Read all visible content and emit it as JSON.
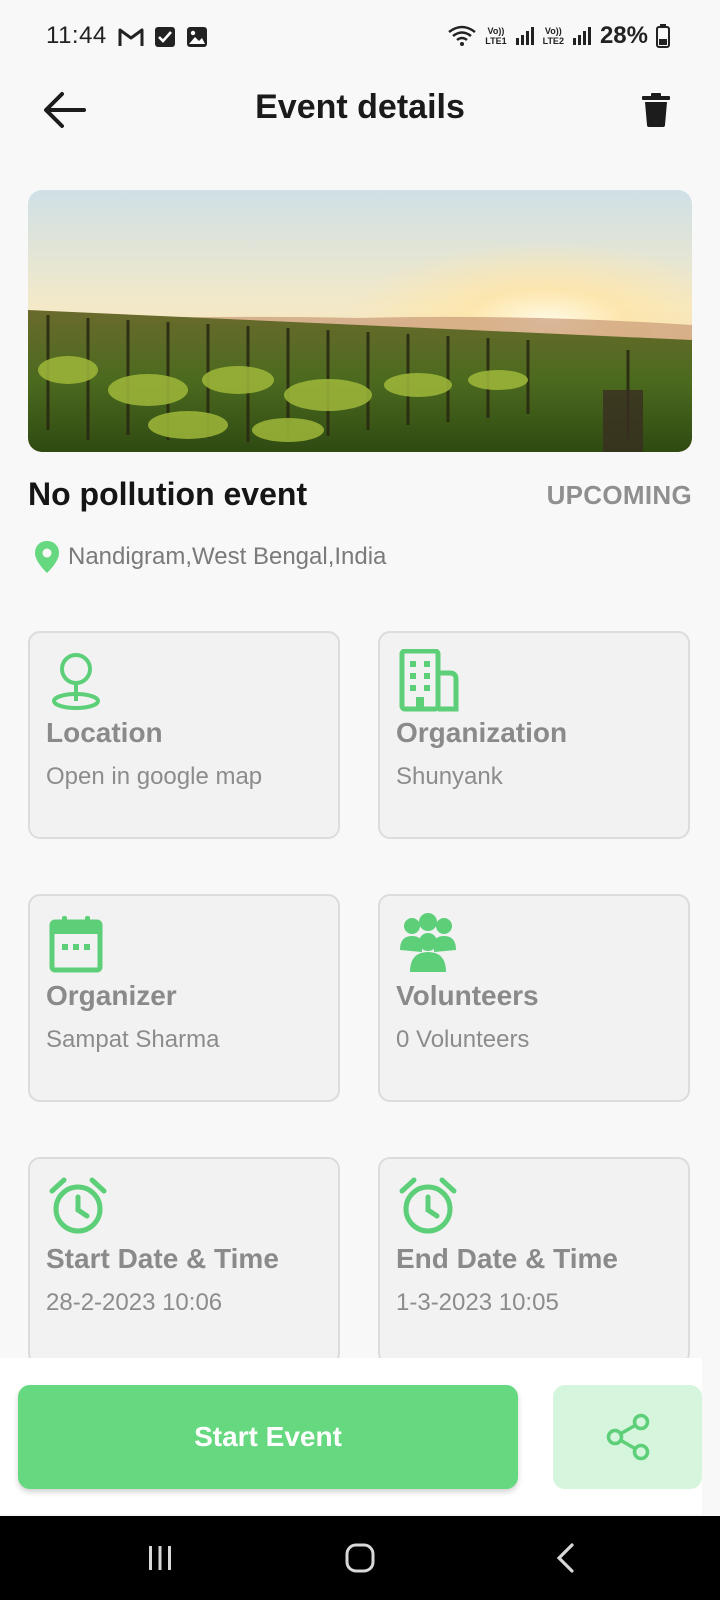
{
  "status_bar": {
    "time": "11:44",
    "battery": "28%",
    "sim1": {
      "top": "Vo))",
      "bottom": "LTE1"
    },
    "sim2": {
      "top": "Vo))",
      "bottom": "LTE2"
    },
    "icons": [
      "gmail-icon",
      "checkbox-icon",
      "gallery-icon",
      "wifi-icon",
      "signal-icon",
      "battery-icon"
    ]
  },
  "header": {
    "title": "Event details",
    "back_icon": "arrow-left-icon",
    "delete_icon": "trash-icon"
  },
  "event": {
    "title": "No pollution event",
    "status": "UPCOMING",
    "location": "Nandigram,West Bengal,India"
  },
  "cards": [
    {
      "title": "Location",
      "subtitle": "Open in google map",
      "icon": "map-pin-icon"
    },
    {
      "title": "Organization",
      "subtitle": "Shunyank",
      "icon": "building-icon"
    },
    {
      "title": "Organizer",
      "subtitle": "Sampat Sharma",
      "icon": "calendar-icon"
    },
    {
      "title": "Volunteers",
      "subtitle": "0 Volunteers",
      "icon": "group-icon"
    },
    {
      "title": "Start Date & Time",
      "subtitle": "28-2-2023 10:06",
      "icon": "alarm-icon"
    },
    {
      "title": "End Date & Time",
      "subtitle": "1-3-2023 10:05",
      "icon": "alarm-icon"
    }
  ],
  "actions": {
    "start_label": "Start Event",
    "share_icon": "share-icon"
  },
  "colors": {
    "accent": "#66d880",
    "icon_green": "#5ccf78",
    "share_bg": "#d6f5dd",
    "status_gray": "#8f8f8f"
  }
}
